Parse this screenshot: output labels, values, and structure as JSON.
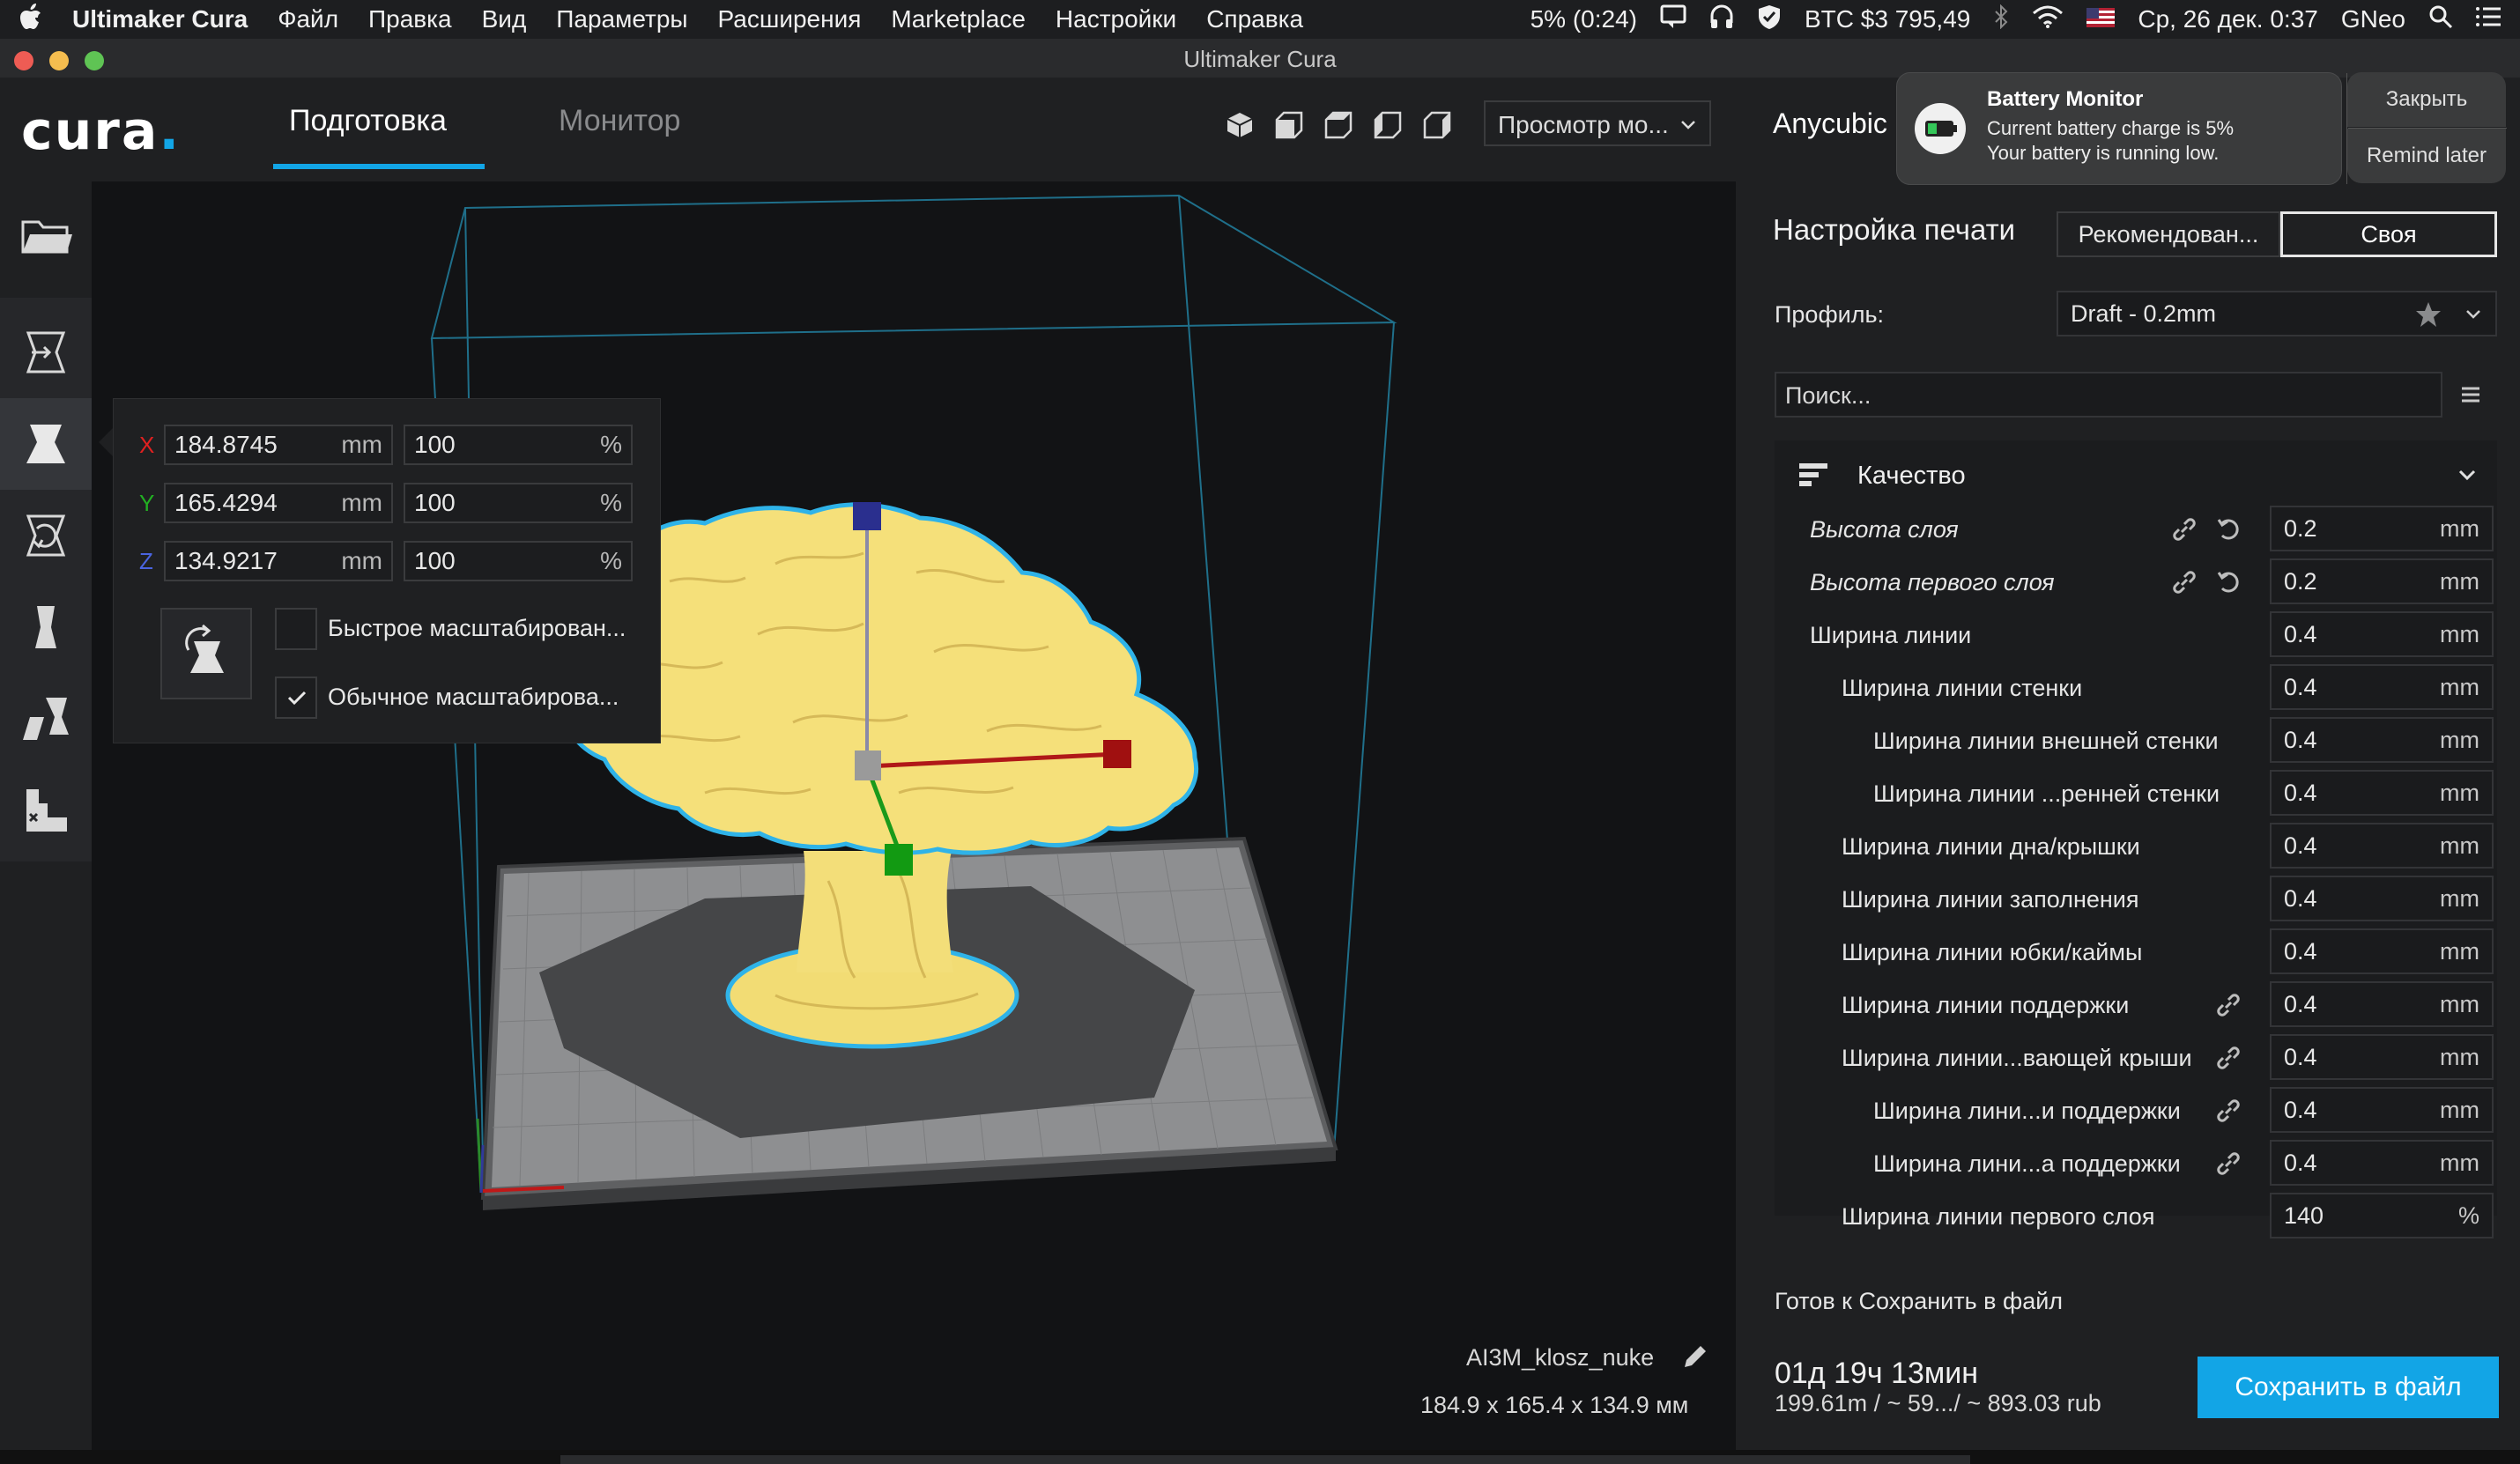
{
  "menubar": {
    "apple": "",
    "items": [
      "Ultimaker Cura",
      "Файл",
      "Правка",
      "Вид",
      "Параметры",
      "Расширения",
      "Marketplace",
      "Настройки",
      "Справка"
    ],
    "battery": "5% (0:24)",
    "btc": "BTC $3 795,49",
    "datetime": "Ср, 26 дек.  0:37",
    "user": "GNeo"
  },
  "window": {
    "title": "Ultimaker Cura"
  },
  "header": {
    "logo": "cura",
    "tabs": [
      {
        "label": "Подготовка",
        "active": true
      },
      {
        "label": "Монитор",
        "active": false
      }
    ],
    "view_select": "Просмотр мо...",
    "printer": "Anycubic"
  },
  "notification": {
    "title": "Battery Monitor",
    "line1": "Current battery charge is 5%",
    "line2": "Your battery is running low.",
    "close": "Закрыть",
    "remind": "Remind later"
  },
  "scale_panel": {
    "rows": [
      {
        "axis": "X",
        "mm": "184.8745",
        "mm_unit": "mm",
        "pct": "100",
        "pct_unit": "%"
      },
      {
        "axis": "Y",
        "mm": "165.4294",
        "mm_unit": "mm",
        "pct": "100",
        "pct_unit": "%"
      },
      {
        "axis": "Z",
        "mm": "134.9217",
        "mm_unit": "mm",
        "pct": "100",
        "pct_unit": "%"
      }
    ],
    "snap_label": "Быстрое масштабирован...",
    "uniform_label": "Обычное масштабирова...",
    "snap_checked": false,
    "uniform_checked": true
  },
  "model": {
    "name": "AI3M_klosz_nuke",
    "dimensions": "184.9 x 165.4 x 134.9 мм"
  },
  "print_settings": {
    "title": "Настройка печати",
    "mode_recommended": "Рекомендован...",
    "mode_custom": "Своя",
    "profile_label": "Профиль:",
    "profile_value": "Draft - 0.2mm",
    "search_placeholder": "Поиск...",
    "section": "Качество",
    "settings": [
      {
        "label": "Высота слоя",
        "value": "0.2",
        "unit": "mm",
        "italic": true,
        "indent": 0,
        "link": true,
        "reset": true
      },
      {
        "label": "Высота первого слоя",
        "value": "0.2",
        "unit": "mm",
        "italic": true,
        "indent": 0,
        "link": true,
        "reset": true
      },
      {
        "label": "Ширина линии",
        "value": "0.4",
        "unit": "mm",
        "italic": false,
        "indent": 0,
        "link": false,
        "reset": false
      },
      {
        "label": "Ширина линии стенки",
        "value": "0.4",
        "unit": "mm",
        "italic": false,
        "indent": 1,
        "link": false,
        "reset": false
      },
      {
        "label": "Ширина линии внешней стенки",
        "value": "0.4",
        "unit": "mm",
        "italic": false,
        "indent": 2,
        "link": false,
        "reset": false
      },
      {
        "label": "Ширина линии ...ренней стенки",
        "value": "0.4",
        "unit": "mm",
        "italic": false,
        "indent": 2,
        "link": false,
        "reset": false
      },
      {
        "label": "Ширина линии дна/крышки",
        "value": "0.4",
        "unit": "mm",
        "italic": false,
        "indent": 1,
        "link": false,
        "reset": false
      },
      {
        "label": "Ширина линии заполнения",
        "value": "0.4",
        "unit": "mm",
        "italic": false,
        "indent": 1,
        "link": false,
        "reset": false
      },
      {
        "label": "Ширина линии юбки/каймы",
        "value": "0.4",
        "unit": "mm",
        "italic": false,
        "indent": 1,
        "link": false,
        "reset": false
      },
      {
        "label": "Ширина линии поддержки",
        "value": "0.4",
        "unit": "mm",
        "italic": false,
        "indent": 1,
        "link": true,
        "reset": false
      },
      {
        "label": "Ширина линии...вающей крыши",
        "value": "0.4",
        "unit": "mm",
        "italic": false,
        "indent": 1,
        "link": true,
        "reset": false
      },
      {
        "label": "Ширина лини...и поддержки",
        "value": "0.4",
        "unit": "mm",
        "italic": false,
        "indent": 2,
        "link": true,
        "reset": false
      },
      {
        "label": "Ширина лини...а поддержки",
        "value": "0.4",
        "unit": "mm",
        "italic": false,
        "indent": 2,
        "link": true,
        "reset": false
      },
      {
        "label": "Ширина линии первого слоя",
        "value": "140",
        "unit": "%",
        "italic": false,
        "indent": 1,
        "link": false,
        "reset": false
      }
    ]
  },
  "output": {
    "status": "Готов к Сохранить в файл",
    "time": "01д 19ч 13мин",
    "material": "199.61m / ~ 59.../ ~ 893.03 rub",
    "save_button": "Сохранить в файл"
  },
  "colors": {
    "accent": "#12a5e6",
    "model": "#f5e07a",
    "outline": "#2fb3e8"
  }
}
